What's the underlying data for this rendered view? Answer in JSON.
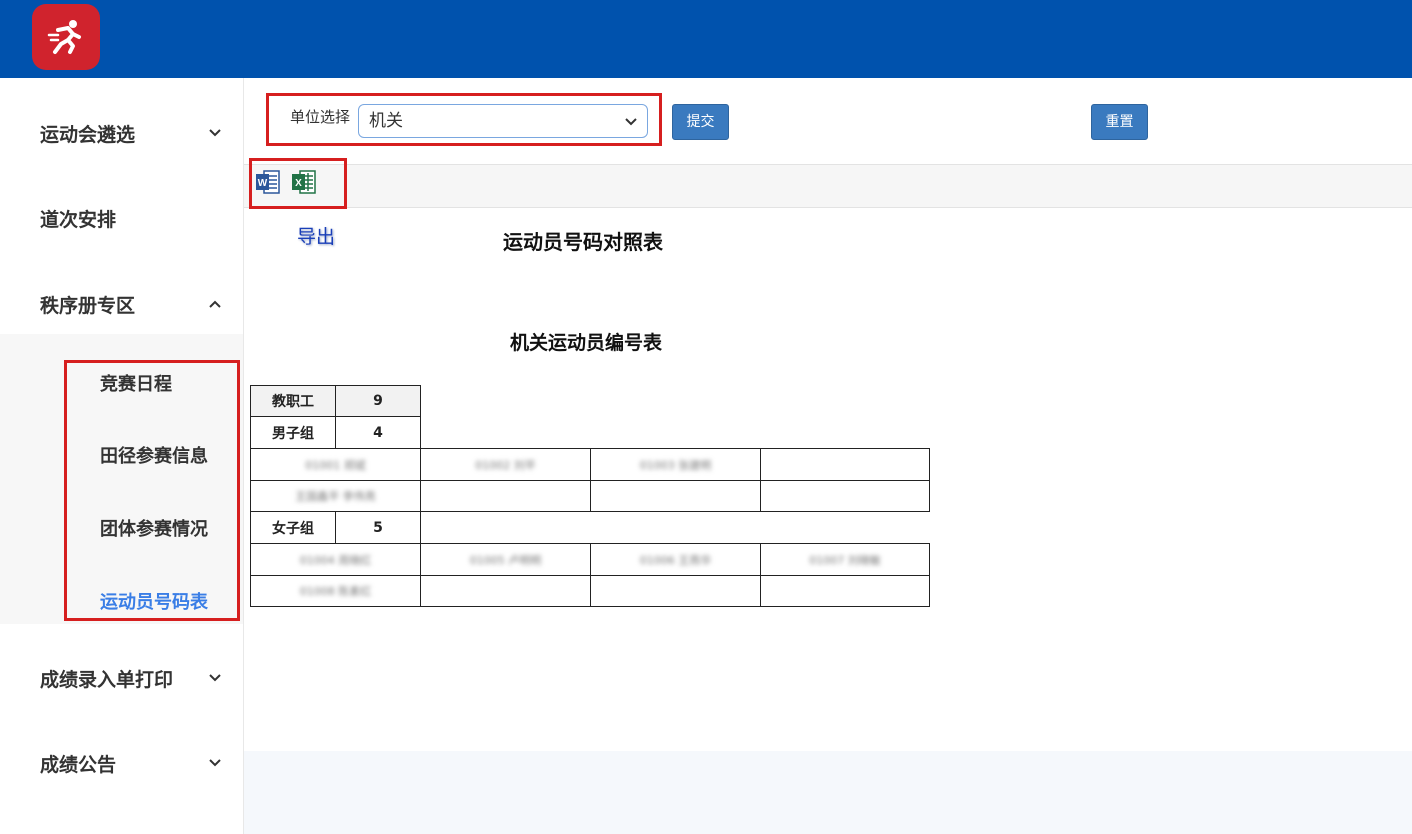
{
  "header": {
    "logo_icon": "runner-icon"
  },
  "sidebar": {
    "items": [
      {
        "label": "运动会遴选",
        "chevron": "down"
      },
      {
        "label": "道次安排"
      },
      {
        "label": "秩序册专区",
        "chevron": "up"
      },
      {
        "label": "成绩录入单打印",
        "chevron": "down"
      },
      {
        "label": "成绩公告",
        "chevron": "down"
      }
    ],
    "subitems": [
      {
        "label": "竞赛日程"
      },
      {
        "label": "田径参赛信息"
      },
      {
        "label": "团体参赛情况"
      },
      {
        "label": "运动员号码表",
        "active": true
      }
    ]
  },
  "form": {
    "unit_label": "单位选择",
    "unit_value": "机关",
    "submit_label": "提交",
    "reset_label": "重置"
  },
  "export": {
    "label": "导出",
    "icons": [
      "word-icon",
      "excel-icon"
    ]
  },
  "report": {
    "title": "运动员号码对照表",
    "subtitle": "机关运动员编号表",
    "category": {
      "label": "教职工",
      "count": "9"
    },
    "groups": [
      {
        "label": "男子组",
        "count": "4",
        "rows": [
          [
            "01001 郑斌",
            "01002 刘平",
            "01003 张建明",
            ""
          ],
          [
            "王国鑫平 李伟亮",
            "",
            "",
            ""
          ]
        ]
      },
      {
        "label": "女子组",
        "count": "5",
        "rows": [
          [
            "01004 周晓红",
            "01005 卢明明",
            "01006 王燕华",
            "01007 刘晓敏"
          ],
          [
            "01008 陈素红",
            "",
            "",
            ""
          ]
        ]
      }
    ]
  },
  "colors": {
    "topbar": "#0052ad",
    "logo": "#d0232d",
    "active": "#3a7ee6",
    "highlight": "#d61f1f",
    "button": "#3a7abf"
  }
}
